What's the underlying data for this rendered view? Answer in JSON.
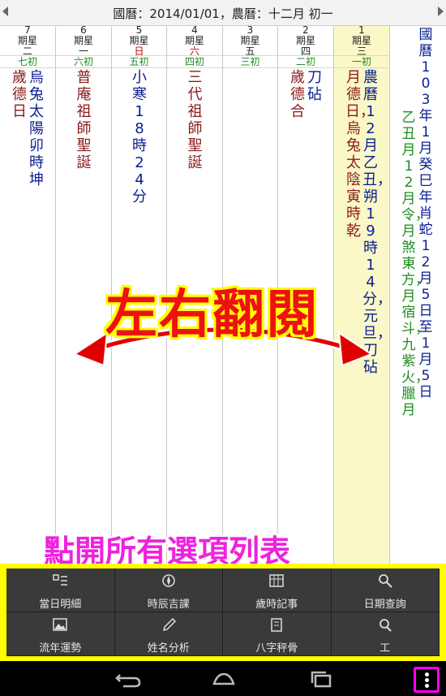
{
  "header": {
    "text": "國曆：2014/01/01，農曆：十二月 初一"
  },
  "days": [
    {
      "num": "7",
      "week_label": "期星",
      "weekday": "二",
      "lunar": "七初",
      "today": false,
      "red": false,
      "lines": [
        {
          "text": "歲德日",
          "color": "red"
        },
        {
          "text": "烏兔太陽卯時坤",
          "color": "blue"
        }
      ]
    },
    {
      "num": "6",
      "week_label": "期星",
      "weekday": "一",
      "lunar": "六初",
      "today": false,
      "red": false,
      "lines": [
        {
          "text": "普庵祖師聖誕",
          "color": "red"
        }
      ]
    },
    {
      "num": "5",
      "week_label": "期星",
      "weekday": "日",
      "lunar": "五初",
      "today": false,
      "red": true,
      "lines": [
        {
          "text": "小寒18時24分",
          "color": "blue"
        }
      ]
    },
    {
      "num": "4",
      "week_label": "期星",
      "weekday": "六",
      "lunar": "四初",
      "today": false,
      "red": true,
      "lines": [
        {
          "text": "三代祖師聖誕",
          "color": "red"
        }
      ]
    },
    {
      "num": "3",
      "week_label": "期星",
      "weekday": "五",
      "lunar": "三初",
      "today": false,
      "red": false,
      "lines": []
    },
    {
      "num": "2",
      "week_label": "期星",
      "weekday": "四",
      "lunar": "二初",
      "today": false,
      "red": false,
      "lines": [
        {
          "text": "歲德合",
          "color": "red"
        },
        {
          "text": "刀砧",
          "color": "blue"
        }
      ]
    },
    {
      "num": "1",
      "week_label": "期星",
      "weekday": "三",
      "lunar": "一初",
      "today": true,
      "red": false,
      "lines": [
        {
          "text": "月德日，烏兔太陰寅時乾",
          "color": "red"
        },
        {
          "text": "農曆12月乙丑，朔19時14分，元旦，刀砧",
          "color": "blue"
        }
      ]
    }
  ],
  "info_panel": {
    "lines": [
      {
        "text": "乙丑月12月令，月煞東方，月宿斗，九紫火，臘月",
        "color": "green"
      },
      {
        "text": "國曆103年1月癸巳年肖蛇12月5日至1月5日",
        "color": "blue"
      }
    ]
  },
  "overlay": {
    "title": "左右翻閱",
    "hint": "點開所有選項列表"
  },
  "menu": {
    "items": [
      {
        "label": "當日明細",
        "icon": "day-detail-icon"
      },
      {
        "label": "時辰吉課",
        "icon": "compass-icon"
      },
      {
        "label": "歲時記事",
        "icon": "calendar-grid-icon"
      },
      {
        "label": "日期查詢",
        "icon": "search-icon"
      },
      {
        "label": "流年運勢",
        "icon": "picture-icon"
      },
      {
        "label": "姓名分析",
        "icon": "pencil-icon"
      },
      {
        "label": "八字秤骨",
        "icon": "notebook-icon"
      },
      {
        "label": "工",
        "icon": "tools-icon"
      }
    ]
  },
  "colors": {
    "accent_yellow": "#ffff00",
    "accent_magenta": "#ff00ff",
    "overlay_red": "#ee1111",
    "today_bg": "#fbf8c8"
  }
}
